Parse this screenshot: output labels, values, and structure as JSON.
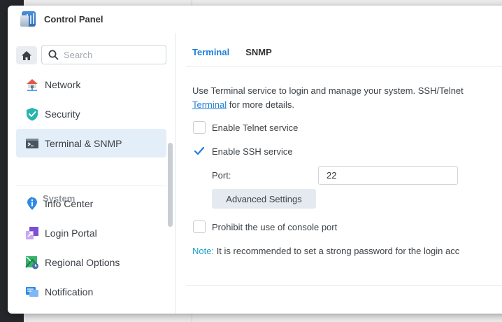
{
  "window": {
    "title": "Control Panel"
  },
  "search": {
    "placeholder": "Search"
  },
  "sidebar": {
    "items": [
      {
        "label": "Network",
        "icon": "network-icon"
      },
      {
        "label": "Security",
        "icon": "shield-icon"
      },
      {
        "label": "Terminal & SNMP",
        "icon": "terminal-icon",
        "active": true
      }
    ],
    "group": {
      "label": "System",
      "icon": "chevron-up-icon"
    },
    "system_items": [
      {
        "label": "Info Center",
        "icon": "info-icon"
      },
      {
        "label": "Login Portal",
        "icon": "login-portal-icon"
      },
      {
        "label": "Regional Options",
        "icon": "regional-options-icon"
      },
      {
        "label": "Notification",
        "icon": "notification-icon"
      }
    ]
  },
  "tabs": [
    {
      "label": "Terminal",
      "active": true
    },
    {
      "label": "SNMP",
      "active": false
    }
  ],
  "main": {
    "description": "Use Terminal service to login and manage your system. SSH/Telnet",
    "description_link": "Terminal",
    "description_tail": " for more details.",
    "telnet_label": "Enable Telnet service",
    "telnet_checked": false,
    "ssh_label": "Enable SSH service",
    "ssh_checked": true,
    "port_label": "Port:",
    "port_value": "22",
    "advanced_label": "Advanced Settings",
    "console_label": "Prohibit the use of console port",
    "console_checked": false,
    "note_label": "Note:",
    "note_text": " It is recommended to set a strong password for the login acc"
  },
  "colors": {
    "accent": "#1f7fd8",
    "note": "#1aa3c8",
    "active_bg": "#e4eef9"
  }
}
